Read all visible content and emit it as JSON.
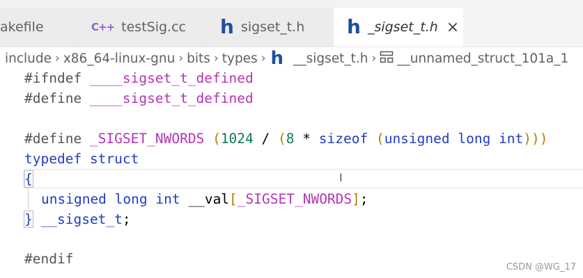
{
  "tabs": [
    {
      "label": "akefile",
      "icon": "makefile-icon"
    },
    {
      "label": "testSig.cc",
      "icon": "cpp-file-icon",
      "icon_text": "C++"
    },
    {
      "label": "sigset_t.h",
      "icon": "header-file-icon",
      "icon_text": "h"
    },
    {
      "label": "_sigset_t.h",
      "icon": "header-file-icon",
      "icon_text": "h",
      "active": true,
      "close": "×"
    }
  ],
  "breadcrumb": {
    "items": [
      "include",
      "x86_64-linux-gnu",
      "bits",
      "types"
    ],
    "file": "__sigset_t.h",
    "file_icon_text": "h",
    "symbol": "__unnamed_struct_101a_1",
    "separator": "›"
  },
  "code": {
    "l1_directive": "#ifndef",
    "l1_macro": "____sigset_t_defined",
    "l2_directive": "#define",
    "l2_macro": "____sigset_t_defined",
    "l4_directive": "#define",
    "l4_macro": "_SIGSET_NWORDS",
    "l4_num1": "1024",
    "l4_num2": "8",
    "l4_sizeof": "sizeof",
    "l4_type": "unsigned long int",
    "l5_typedef": "typedef",
    "l5_struct": "struct",
    "l6_open": "{",
    "l7_type": "unsigned long int",
    "l7_field": "__val",
    "l7_macro": "_SIGSET_NWORDS",
    "l8_close": "}",
    "l8_name": "__sigset_t",
    "l10_directive": "#endif"
  },
  "cursor_glyph": "I",
  "watermark": "CSDN @WG_17",
  "colors": {
    "keyword": "#1f3ec2",
    "macro": "#b436b4",
    "number": "#0f7a4f",
    "paren": "#b08000",
    "header_icon": "#1e4f9b",
    "cpp_icon": "#8a63d2"
  }
}
